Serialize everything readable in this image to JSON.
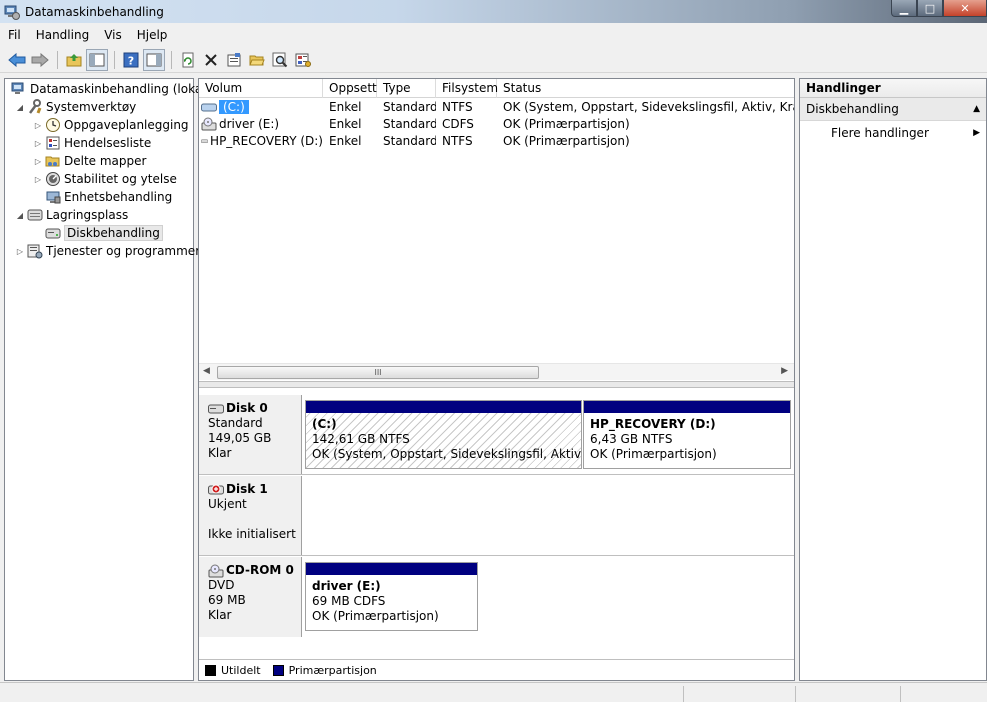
{
  "window": {
    "title": "Datamaskinbehandling"
  },
  "menu": [
    "Fil",
    "Handling",
    "Vis",
    "Hjelp"
  ],
  "tree": {
    "root": "Datamaskinbehandling (lokal)",
    "systemverktoy": "Systemverktøy",
    "oppgaveplanlegging": "Oppgaveplanlegging",
    "hendelsesliste": "Hendelsesliste",
    "delte_mapper": "Delte mapper",
    "stabilitet": "Stabilitet og ytelse",
    "enhetsbehandling": "Enhetsbehandling",
    "lagringsplass": "Lagringsplass",
    "diskbehandling": "Diskbehandling",
    "tjenester": "Tjenester og programmer"
  },
  "volumes": {
    "headers": [
      "Volum",
      "Oppsett",
      "Type",
      "Filsystem",
      "Status"
    ],
    "rows": [
      {
        "volum": "(C:)",
        "oppsett": "Enkel",
        "type": "Standard",
        "fs": "NTFS",
        "status": "OK (System, Oppstart, Sidevekslingsfil, Aktiv, Krasjdump"
      },
      {
        "volum": "driver (E:)",
        "oppsett": "Enkel",
        "type": "Standard",
        "fs": "CDFS",
        "status": "OK (Primærpartisjon)"
      },
      {
        "volum": "HP_RECOVERY (D:)",
        "oppsett": "Enkel",
        "type": "Standard",
        "fs": "NTFS",
        "status": "OK (Primærpartisjon)"
      }
    ]
  },
  "scroll_thumb": "III",
  "disks": {
    "disk0": {
      "name": "Disk 0",
      "type": "Standard",
      "size": "149,05 GB",
      "state": "Klar"
    },
    "disk1": {
      "name": "Disk 1",
      "type": "Ukjent",
      "size": "",
      "state": "Ikke initialisert"
    },
    "cdrom0": {
      "name": "CD-ROM 0",
      "type": "DVD",
      "size": "69 MB",
      "state": "Klar"
    }
  },
  "partitions": {
    "c": {
      "name": "(C:)",
      "size": "142,61 GB NTFS",
      "status": "OK (System, Oppstart, Sidevekslingsfil, Aktiv, Krasj"
    },
    "d": {
      "name": "HP_RECOVERY  (D:)",
      "size": "6,43 GB NTFS",
      "status": "OK (Primærpartisjon)"
    },
    "e": {
      "name": "driver  (E:)",
      "size": "69 MB CDFS",
      "status": "OK (Primærpartisjon)"
    }
  },
  "legend": {
    "unallocated": "Utildelt",
    "primary": "Primærpartisjon"
  },
  "actions": {
    "header": "Handlinger",
    "section": "Diskbehandling",
    "more": "Flere handlinger"
  },
  "colors": {
    "primary_partition": "#000080",
    "unallocated": "#000000"
  }
}
